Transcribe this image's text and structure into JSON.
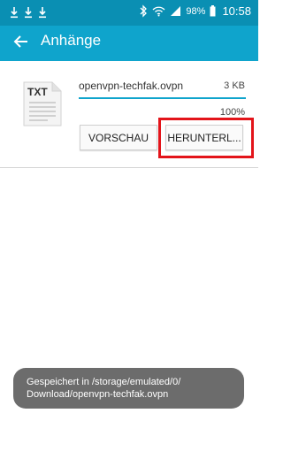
{
  "status_bar": {
    "battery_text": "98%",
    "time": "10:58",
    "icons": [
      "download-icon",
      "download-icon",
      "download-icon",
      "bluetooth-icon",
      "wifi-icon",
      "signal-icon",
      "battery-icon"
    ]
  },
  "app_bar": {
    "title": "Anhänge",
    "back_icon": "back-arrow-icon"
  },
  "attachment": {
    "type_label": "TXT",
    "file_name": "openvpn-techfak.ovpn",
    "file_size": "3 KB",
    "progress_percent_text": "100%",
    "progress_fraction": 1.0,
    "preview_label": "VORSCHAU",
    "download_label": "HERUNTERL..."
  },
  "toast": {
    "line1": "Gespeichert in /storage/emulated/0/",
    "line2": "Download/openvpn-techfak.ovpn"
  },
  "colors": {
    "status_bar": "#0a8fb3",
    "app_bar": "#0fa4cc",
    "highlight": "#e3141a",
    "toast_bg": "#6c6c6c"
  }
}
